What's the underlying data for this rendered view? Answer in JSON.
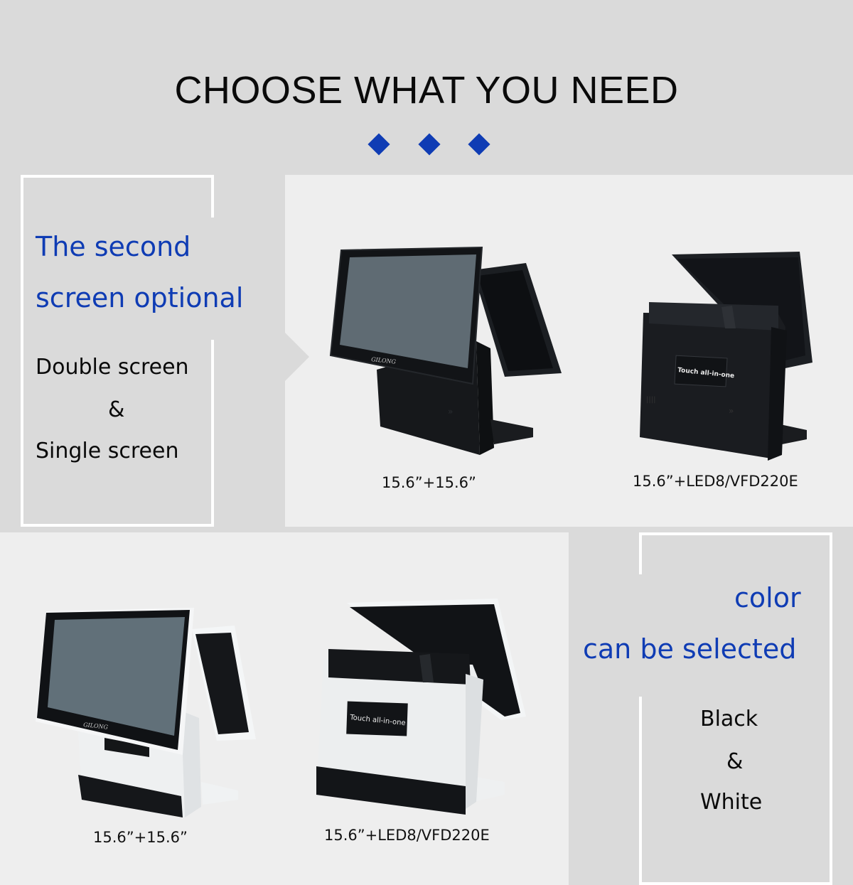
{
  "header": {
    "title": "CHOOSE WHAT YOU NEED",
    "decoration": [
      "diamond-icon",
      "diamond-icon",
      "diamond-icon"
    ]
  },
  "colors": {
    "accent": "#0f3cb4",
    "background": "#dadada",
    "panel": "#eeeeee",
    "text": "#0a0a0a"
  },
  "section_screens": {
    "heading_line1": "The second",
    "heading_line2": "screen optional",
    "option_1": "Double screen",
    "separator": "&",
    "option_2": "Single screen",
    "products": [
      {
        "color": "black",
        "label": "15.6”+15.6”",
        "brand": "GILONG"
      },
      {
        "color": "black",
        "label": "15.6”+LED8/VFD220E",
        "badge": "Touch all-in-one"
      }
    ]
  },
  "section_color": {
    "heading_line1": "color",
    "heading_line2": "can be selected",
    "option_1": "Black",
    "separator": "&",
    "option_2": "White",
    "products": [
      {
        "color": "white",
        "label": "15.6”+15.6”",
        "brand": "GILONG"
      },
      {
        "color": "white",
        "label": "15.6”+LED8/VFD220E",
        "badge": "Touch all-in-one"
      }
    ]
  }
}
